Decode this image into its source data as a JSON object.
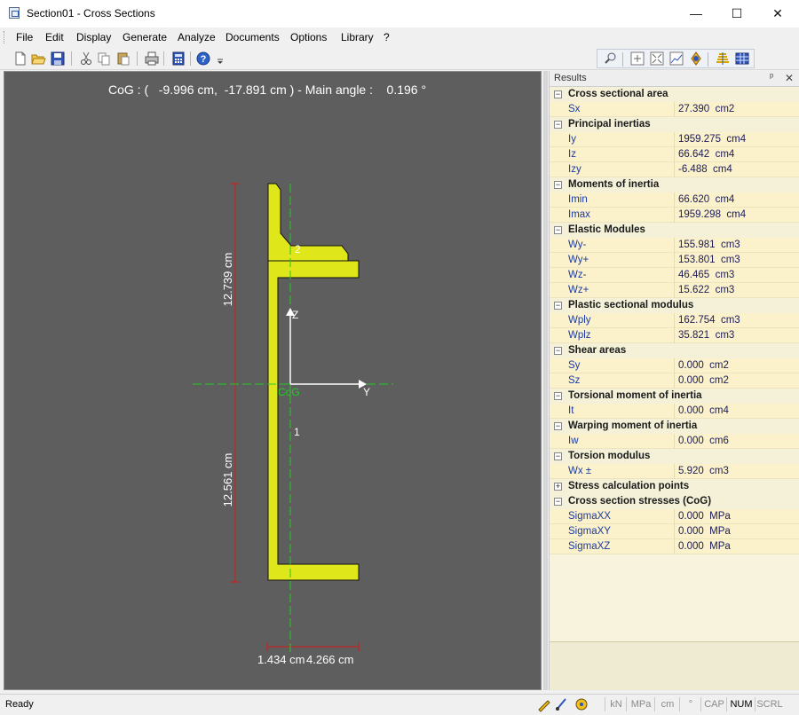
{
  "window": {
    "title": "Section01 - Cross Sections",
    "minimize": "—",
    "maximize": "☐",
    "close": "✕"
  },
  "menu": [
    "File",
    "Edit",
    "Display",
    "Generate",
    "Analyze",
    "Documents",
    "Options",
    "Library",
    "?"
  ],
  "toolbar": {
    "left": [
      "new-icon",
      "open-icon",
      "save-icon",
      "cut-icon",
      "copy-icon",
      "paste-icon",
      "print-icon",
      "calculator-icon",
      "help-icon"
    ],
    "right": [
      "zoom-icon",
      "fit-icon",
      "fullscreen-icon",
      "chart-icon",
      "rotate-icon",
      "layers-icon",
      "table-icon"
    ]
  },
  "canvas": {
    "cog_text": "CoG : (   -9.996 cm,  -17.891 cm ) - Main angle :    0.196 °",
    "dim_top": "12.739 cm",
    "dim_bottom": "12.561 cm",
    "dim_width": "1.434 cm",
    "dim_width2": "4.266 cm",
    "axis_y": "Y",
    "axis_z": "Z",
    "cog_label": "CoG",
    "point1": "1",
    "point2": "2"
  },
  "results": {
    "title": "Results",
    "pin": "ᵖ",
    "close": "✕",
    "groups": [
      {
        "label": "Cross sectional area",
        "expanded": true,
        "items": [
          {
            "name": "Sx",
            "value": "27.390",
            "unit": "cm2"
          }
        ]
      },
      {
        "label": "Principal inertias",
        "expanded": true,
        "items": [
          {
            "name": "Iy",
            "value": "1959.275",
            "unit": "cm4"
          },
          {
            "name": "Iz",
            "value": "66.642",
            "unit": "cm4"
          },
          {
            "name": "Izy",
            "value": "-6.488",
            "unit": "cm4"
          }
        ]
      },
      {
        "label": "Moments of inertia",
        "expanded": true,
        "items": [
          {
            "name": "Imin",
            "value": "66.620",
            "unit": "cm4"
          },
          {
            "name": "Imax",
            "value": "1959.298",
            "unit": "cm4"
          }
        ]
      },
      {
        "label": "Elastic Modules",
        "expanded": true,
        "items": [
          {
            "name": "Wy-",
            "value": "155.981",
            "unit": "cm3"
          },
          {
            "name": "Wy+",
            "value": "153.801",
            "unit": "cm3"
          },
          {
            "name": "Wz-",
            "value": "46.465",
            "unit": "cm3"
          },
          {
            "name": "Wz+",
            "value": "15.622",
            "unit": "cm3"
          }
        ]
      },
      {
        "label": "Plastic sectional modulus",
        "expanded": true,
        "items": [
          {
            "name": "Wply",
            "value": "162.754",
            "unit": "cm3"
          },
          {
            "name": "Wplz",
            "value": "35.821",
            "unit": "cm3"
          }
        ]
      },
      {
        "label": "Shear areas",
        "expanded": true,
        "items": [
          {
            "name": "Sy",
            "value": "0.000",
            "unit": "cm2"
          },
          {
            "name": "Sz",
            "value": "0.000",
            "unit": "cm2"
          }
        ]
      },
      {
        "label": "Torsional moment of inertia",
        "expanded": true,
        "items": [
          {
            "name": "It",
            "value": "0.000",
            "unit": "cm4"
          }
        ]
      },
      {
        "label": "Warping moment of inertia",
        "expanded": true,
        "items": [
          {
            "name": "Iw",
            "value": "0.000",
            "unit": "cm6"
          }
        ]
      },
      {
        "label": "Torsion modulus",
        "expanded": true,
        "items": [
          {
            "name": "Wx ±",
            "value": "5.920",
            "unit": "cm3"
          }
        ]
      },
      {
        "label": "Stress calculation points",
        "expanded": false,
        "items": []
      },
      {
        "label": "Cross section stresses (CoG)",
        "expanded": true,
        "items": [
          {
            "name": "SigmaXX",
            "value": "0.000",
            "unit": "MPa"
          },
          {
            "name": "SigmaXY",
            "value": "0.000",
            "unit": "MPa"
          },
          {
            "name": "SigmaXZ",
            "value": "0.000",
            "unit": "MPa"
          }
        ]
      }
    ]
  },
  "status": {
    "text": "Ready",
    "indicators": [
      "kN",
      "MPa",
      "cm",
      "°",
      "CAP",
      "NUM",
      "SCRL"
    ],
    "active": [
      "NUM"
    ]
  },
  "colors": {
    "section_fill": "#dfe61a",
    "canvas_bg": "#5e5e5e",
    "dimension": "#d81818",
    "axis": "#22cc22",
    "panel_bg": "#f7f3dc"
  }
}
